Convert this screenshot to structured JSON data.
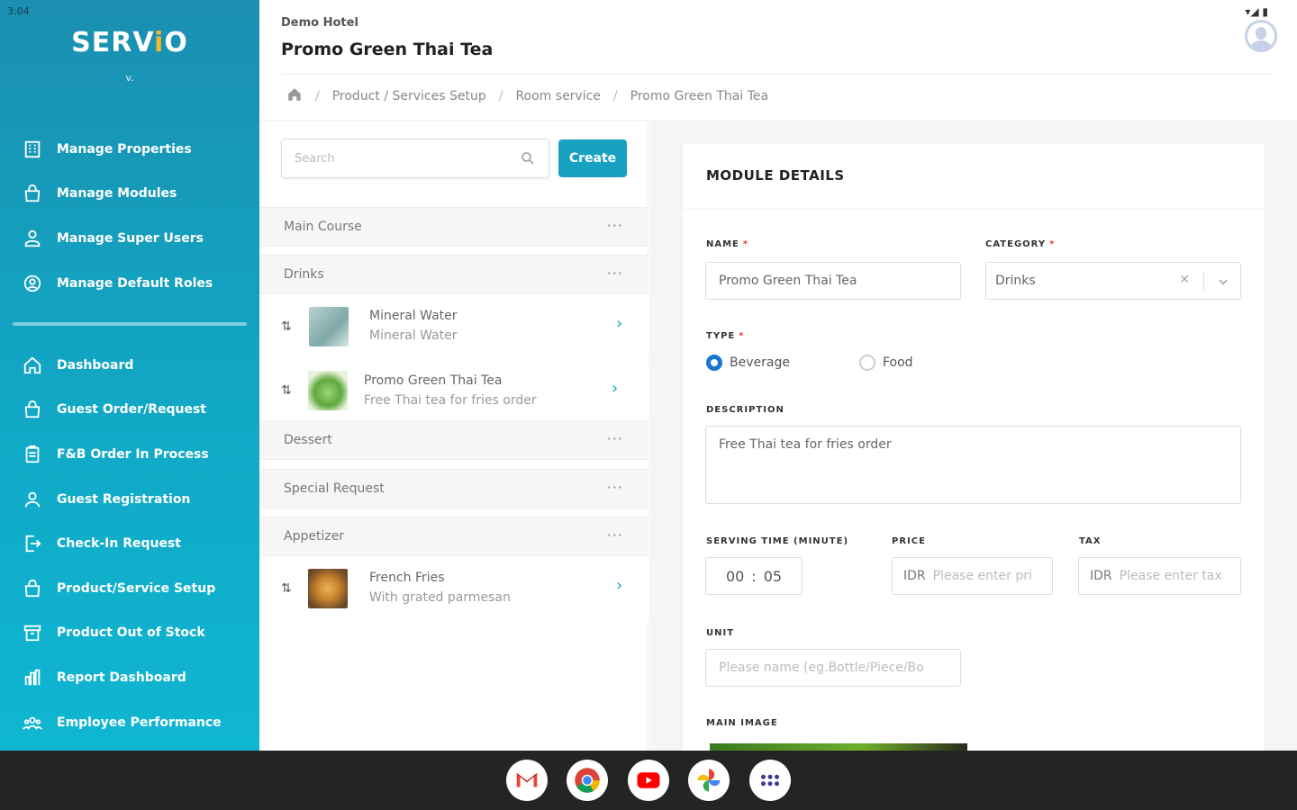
{
  "status": {
    "time": "3:04",
    "icons": "▾◢ ▮"
  },
  "brand": {
    "logo_pre": "SERV",
    "logo_dot": "i",
    "logo_post": "O",
    "version": "v."
  },
  "sidebar": {
    "admin_items": [
      {
        "label": "Manage Properties",
        "icon": "building-icon"
      },
      {
        "label": "Manage Modules",
        "icon": "bag-icon"
      },
      {
        "label": "Manage Super Users",
        "icon": "users-icon"
      },
      {
        "label": "Manage Default Roles",
        "icon": "role-icon"
      }
    ],
    "main_items": [
      {
        "label": "Dashboard",
        "icon": "home-icon"
      },
      {
        "label": "Guest Order/Request",
        "icon": "bag-icon"
      },
      {
        "label": "F&B Order In Process",
        "icon": "clipboard-icon"
      },
      {
        "label": "Guest Registration",
        "icon": "user-icon"
      },
      {
        "label": "Check-In Request",
        "icon": "checkin-icon"
      },
      {
        "label": "Product/Service Setup",
        "icon": "bag-icon"
      },
      {
        "label": "Product Out of Stock",
        "icon": "archive-icon"
      },
      {
        "label": "Report Dashboard",
        "icon": "chart-icon"
      },
      {
        "label": "Employee Performance",
        "icon": "team-icon"
      }
    ]
  },
  "header": {
    "hotel": "Demo Hotel",
    "title": "Promo Green Thai Tea",
    "breadcrumb": [
      "Product / Services Setup",
      "Room service",
      "Promo Green Thai Tea"
    ]
  },
  "list": {
    "search_placeholder": "Search",
    "create_label": "Create",
    "more": "···",
    "drag": "⇅",
    "chevron": "›",
    "categories": [
      "Main Course",
      "Drinks",
      "Dessert",
      "Special Request",
      "Appetizer"
    ],
    "products": [
      {
        "name": "Mineral Water",
        "desc": "Mineral Water"
      },
      {
        "name": "Promo Green Thai Tea",
        "desc": "Free Thai tea for fries order"
      },
      {
        "name": "French Fries",
        "desc": "With grated parmesan"
      }
    ]
  },
  "detail": {
    "title": "MODULE DETAILS",
    "name_label": "NAME",
    "name_value": "Promo Green Thai Tea",
    "category_label": "CATEGORY",
    "category_value": "Drinks",
    "type_label": "TYPE",
    "type_options": [
      "Beverage",
      "Food"
    ],
    "type_selected": "Beverage",
    "description_label": "DESCRIPTION",
    "description_value": "Free Thai tea for fries order",
    "serving_label": "SERVING TIME (MINUTE)",
    "serving_hours": "00",
    "serving_minutes": "05",
    "price_label": "PRICE",
    "price_prefix": "IDR",
    "price_placeholder": "Please enter pri",
    "tax_label": "TAX",
    "tax_prefix": "IDR",
    "tax_placeholder": "Please enter tax",
    "unit_label": "UNIT",
    "unit_placeholder": "Please name (eg.Bottle/Piece/Bo",
    "image_label": "MAIN IMAGE",
    "required_mark": "*"
  },
  "colors": {
    "accent": "#17a2c2",
    "radio": "#1976d2",
    "required": "#e53935"
  }
}
